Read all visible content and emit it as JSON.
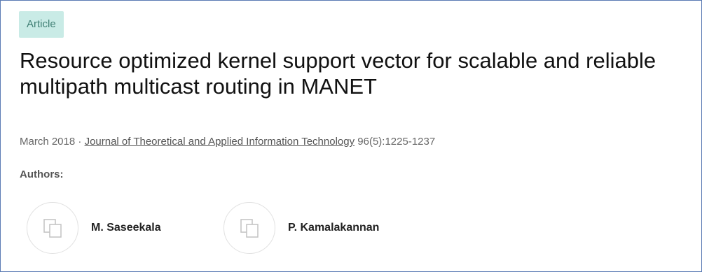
{
  "badge": {
    "label": "Article"
  },
  "publication": {
    "title": "Resource optimized kernel support vector for scalable and reliable multipath multicast routing in MANET",
    "date": "March 2018",
    "separator": " · ",
    "journal": "Journal of Theoretical and Applied Information Technology",
    "volume_pages": " 96(5):1225-1237"
  },
  "authors": {
    "label": "Authors:",
    "items": [
      {
        "name": "M. Saseekala",
        "icon": "avatar-placeholder-icon"
      },
      {
        "name": "P. Kamalakannan",
        "icon": "avatar-placeholder-icon"
      }
    ]
  },
  "colors": {
    "badge_bg": "#c9ebe6",
    "badge_text": "#3f7f74",
    "frame_border": "#5b7bb4"
  }
}
